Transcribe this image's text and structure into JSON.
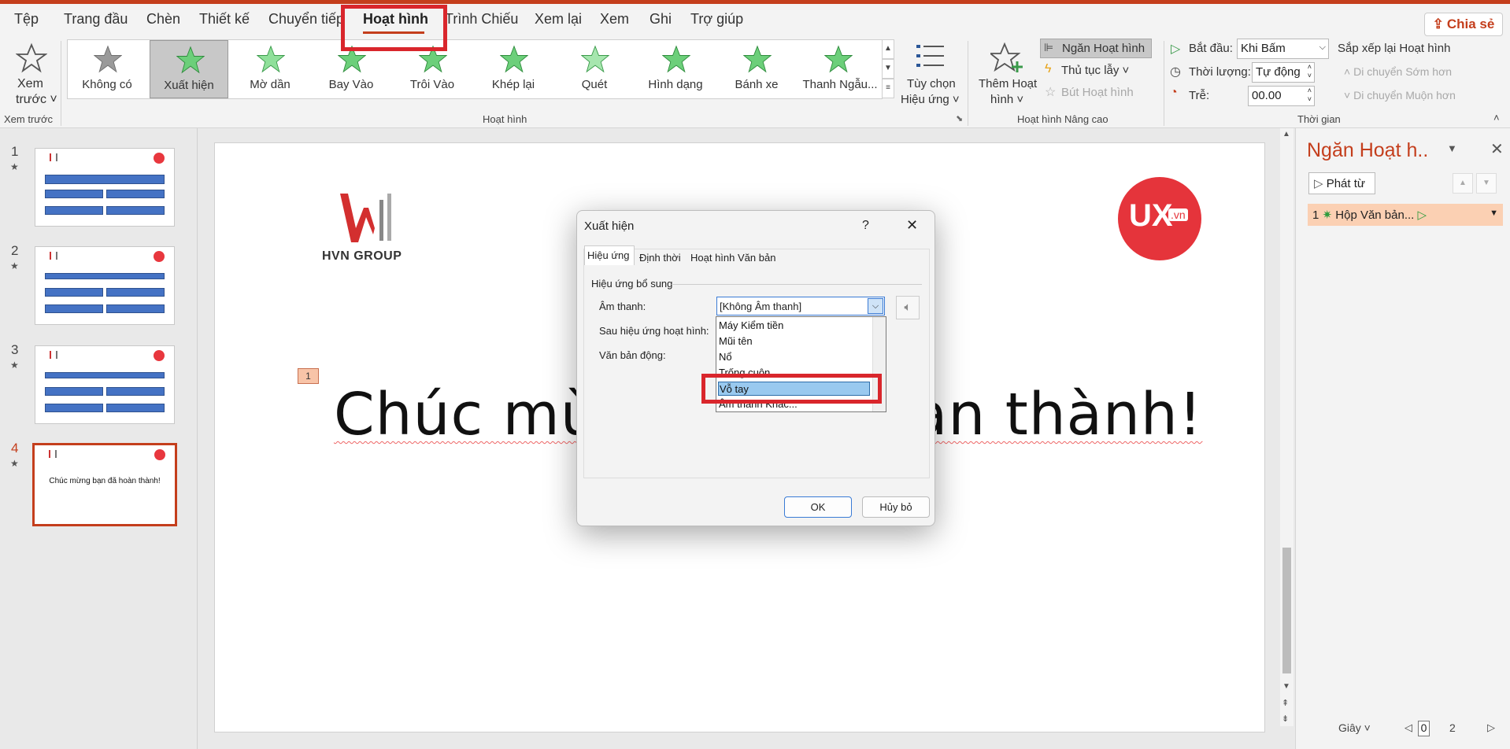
{
  "menu": {
    "items": [
      "Tệp",
      "Trang đầu",
      "Chèn",
      "Thiết kế",
      "Chuyển tiếp",
      "Hoạt hình",
      "Trình Chiếu",
      "Xem lại",
      "Xem",
      "Ghi",
      "Trợ giúp"
    ],
    "share_label": "Chia sẻ"
  },
  "ribbon": {
    "preview": {
      "line1": "Xem",
      "line2": "trước ˅",
      "group": "Xem trước"
    },
    "gallery": [
      {
        "label": "Không có",
        "icon": "star-gray-icon"
      },
      {
        "label": "Xuất hiện",
        "icon": "star-burst-icon",
        "selected": true
      },
      {
        "label": "Mờ dần",
        "icon": "star-green-icon"
      },
      {
        "label": "Bay Vào",
        "icon": "star-fly-icon"
      },
      {
        "label": "Trôi Vào",
        "icon": "star-float-icon"
      },
      {
        "label": "Khép lại",
        "icon": "star-split-icon"
      },
      {
        "label": "Quét",
        "icon": "star-wipe-icon"
      },
      {
        "label": "Hình dạng",
        "icon": "star-shape-icon"
      },
      {
        "label": "Bánh xe",
        "icon": "star-wheel-icon"
      },
      {
        "label": "Thanh Ngẫu...",
        "icon": "star-bars-icon"
      }
    ],
    "animation_group": "Hoạt hình",
    "effect_options": {
      "line1": "Tùy chọn",
      "line2": "Hiệu ứng ˅"
    },
    "add_animation": {
      "line1": "Thêm Hoạt",
      "line2": "hình ˅"
    },
    "animation_pane_btn": "Ngăn Hoạt hình",
    "trigger_btn": "Thủ tục lẫy ˅",
    "painter_btn": "Bút Hoạt hình",
    "advanced_group": "Hoạt hình Nâng cao",
    "timing": {
      "start_label": "Bắt đầu:",
      "start_value": "Khi Bấm",
      "duration_label": "Thời lượng:",
      "duration_value": "Tự động",
      "delay_label": "Trễ:",
      "delay_value": "00.00",
      "reorder_label": "Sắp xếp lại Hoạt hình",
      "move_earlier": "Di chuyển Sớm hơn",
      "move_later": "Di chuyển Muộn hơn",
      "group": "Thời gian"
    }
  },
  "slides": [
    {
      "num": "1",
      "star": "★"
    },
    {
      "num": "2",
      "star": "★"
    },
    {
      "num": "3",
      "star": "★"
    },
    {
      "num": "4",
      "star": "★",
      "text": "Chúc mừng bạn đã hoàn thành!"
    }
  ],
  "canvas": {
    "logo_text": "HVN GROUP",
    "ux_text": "UX",
    "ux_suffix": ".vn",
    "anim_tag": "1",
    "headline_left": "Chúc mừ",
    "headline_right": "àn thành!"
  },
  "dialog": {
    "title": "Xuất hiện",
    "help": "?",
    "close": "✕",
    "tabs": [
      "Hiệu ứng",
      "Định thời",
      "Hoạt hình Văn bản"
    ],
    "section": "Hiệu ứng bổ sung",
    "sound_label": "Âm thanh:",
    "sound_value": "[Không Âm thanh]",
    "after_label": "Sau hiệu ứng hoạt hình:",
    "text_label": "Văn bản động:",
    "ok": "OK",
    "cancel": "Hủy bỏ",
    "dropdown": [
      "Máy Kiểm tiền",
      "Mũi tên",
      "Nổ",
      "Trống cuộn",
      "Vỗ tay",
      "Âm thanh Khác..."
    ],
    "dropdown_selected": "Vỗ tay"
  },
  "pane": {
    "title": "Ngăn Hoạt h..",
    "play_from": "Phát từ",
    "item_num": "1",
    "item_label": "Hộp Văn bản..."
  },
  "status": {
    "seconds": "Giây ˅",
    "zoom_from": "0",
    "zoom_to": "2"
  },
  "colors": {
    "accent": "#c43e1c",
    "highlight_red": "#d9262c",
    "selected_item": "#99c9ef",
    "pane_item": "#fbd0b3"
  }
}
